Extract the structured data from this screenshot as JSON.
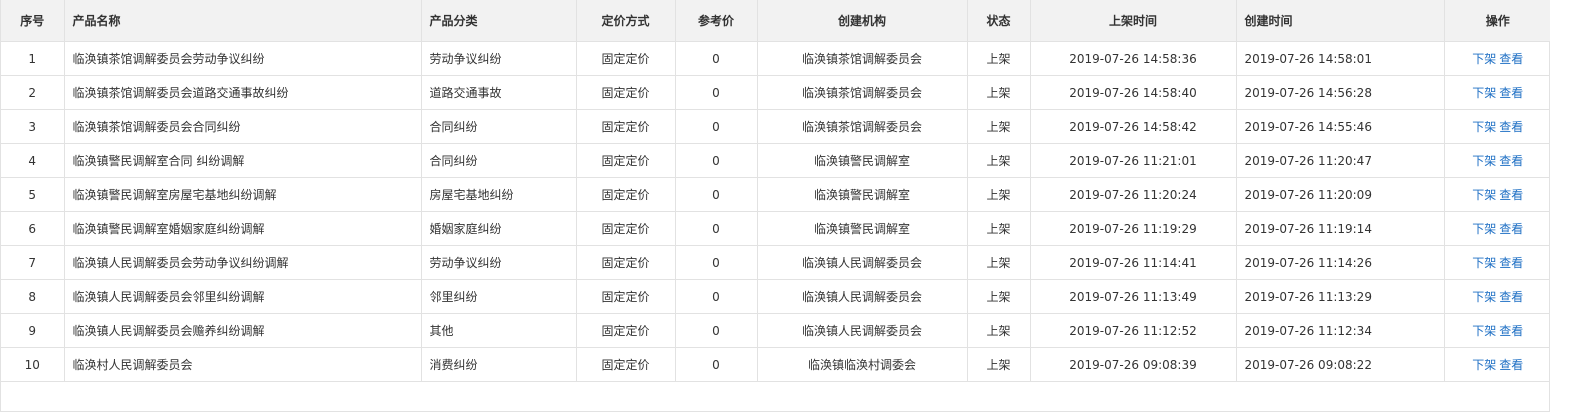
{
  "table": {
    "headers": {
      "index": "序号",
      "name": "产品名称",
      "category": "产品分类",
      "pricing": "定价方式",
      "ref_price": "参考价",
      "org": "创建机构",
      "status": "状态",
      "listed_time": "上架时间",
      "created_time": "创建时间",
      "actions": "操作"
    },
    "action_labels": {
      "unlist": "下架",
      "view": "查看"
    },
    "rows": [
      {
        "index": "1",
        "name": "临涣镇茶馆调解委员会劳动争议纠纷",
        "category": "劳动争议纠纷",
        "pricing": "固定定价",
        "ref_price": "0",
        "org": "临涣镇茶馆调解委员会",
        "status": "上架",
        "listed_time": "2019-07-26 14:58:36",
        "created_time": "2019-07-26 14:58:01"
      },
      {
        "index": "2",
        "name": "临涣镇茶馆调解委员会道路交通事故纠纷",
        "category": "道路交通事故",
        "pricing": "固定定价",
        "ref_price": "0",
        "org": "临涣镇茶馆调解委员会",
        "status": "上架",
        "listed_time": "2019-07-26 14:58:40",
        "created_time": "2019-07-26 14:56:28"
      },
      {
        "index": "3",
        "name": "临涣镇茶馆调解委员会合同纠纷",
        "category": "合同纠纷",
        "pricing": "固定定价",
        "ref_price": "0",
        "org": "临涣镇茶馆调解委员会",
        "status": "上架",
        "listed_time": "2019-07-26 14:58:42",
        "created_time": "2019-07-26 14:55:46"
      },
      {
        "index": "4",
        "name": "临涣镇警民调解室合同 纠纷调解",
        "category": "合同纠纷",
        "pricing": "固定定价",
        "ref_price": "0",
        "org": "临涣镇警民调解室",
        "status": "上架",
        "listed_time": "2019-07-26 11:21:01",
        "created_time": "2019-07-26 11:20:47"
      },
      {
        "index": "5",
        "name": "临涣镇警民调解室房屋宅基地纠纷调解",
        "category": "房屋宅基地纠纷",
        "pricing": "固定定价",
        "ref_price": "0",
        "org": "临涣镇警民调解室",
        "status": "上架",
        "listed_time": "2019-07-26 11:20:24",
        "created_time": "2019-07-26 11:20:09"
      },
      {
        "index": "6",
        "name": "临涣镇警民调解室婚姻家庭纠纷调解",
        "category": "婚姻家庭纠纷",
        "pricing": "固定定价",
        "ref_price": "0",
        "org": "临涣镇警民调解室",
        "status": "上架",
        "listed_time": "2019-07-26 11:19:29",
        "created_time": "2019-07-26 11:19:14"
      },
      {
        "index": "7",
        "name": "临涣镇人民调解委员会劳动争议纠纷调解",
        "category": "劳动争议纠纷",
        "pricing": "固定定价",
        "ref_price": "0",
        "org": "临涣镇人民调解委员会",
        "status": "上架",
        "listed_time": "2019-07-26 11:14:41",
        "created_time": "2019-07-26 11:14:26"
      },
      {
        "index": "8",
        "name": "临涣镇人民调解委员会邻里纠纷调解",
        "category": "邻里纠纷",
        "pricing": "固定定价",
        "ref_price": "0",
        "org": "临涣镇人民调解委员会",
        "status": "上架",
        "listed_time": "2019-07-26 11:13:49",
        "created_time": "2019-07-26 11:13:29"
      },
      {
        "index": "9",
        "name": "临涣镇人民调解委员会赡养纠纷调解",
        "category": "其他",
        "pricing": "固定定价",
        "ref_price": "0",
        "org": "临涣镇人民调解委员会",
        "status": "上架",
        "listed_time": "2019-07-26 11:12:52",
        "created_time": "2019-07-26 11:12:34"
      },
      {
        "index": "10",
        "name": "临涣村人民调解委员会",
        "category": "消费纠纷",
        "pricing": "固定定价",
        "ref_price": "0",
        "org": "临涣镇临涣村调委会",
        "status": "上架",
        "listed_time": "2019-07-26 09:08:39",
        "created_time": "2019-07-26 09:08:22"
      }
    ]
  }
}
